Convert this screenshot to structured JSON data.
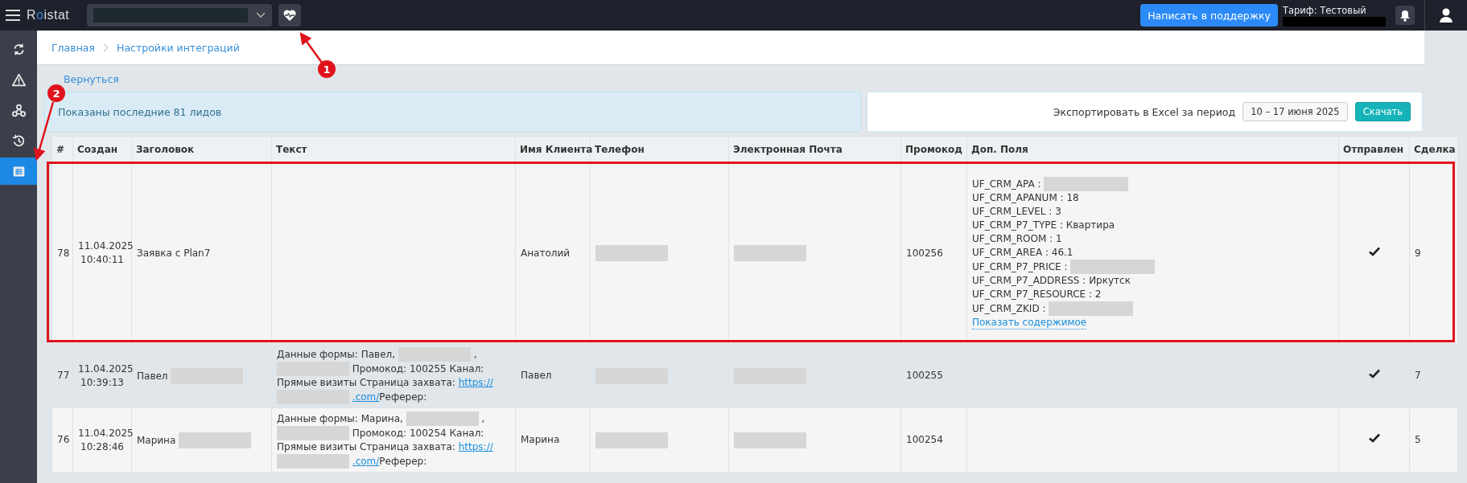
{
  "topbar": {
    "logo": "Roistat",
    "support_button": "Написать в поддержку",
    "tariff": "Тариф: Тестовый"
  },
  "sidebar": {
    "items": [
      {
        "selected": false
      },
      {
        "selected": false
      },
      {
        "selected": false
      },
      {
        "selected": false
      },
      {
        "selected": true
      }
    ]
  },
  "breadcrumbs": [
    "Главная",
    "Настройки интеграций"
  ],
  "back_link": "Вернуться",
  "info": "Показаны последние 81 лидов",
  "export": {
    "label": "Экспортировать в Excel за период",
    "period": "10 – 17 июня 2025",
    "button": "Скачать"
  },
  "table": {
    "columns": [
      "#",
      "Создан",
      "Заголовок",
      "Текст",
      "Имя Клиента",
      "Телефон",
      "Электронная Почта",
      "Промокод",
      "Доп. Поля",
      "Отправлен",
      "Сделка"
    ],
    "rows": [
      {
        "num": "78",
        "date": "11.04.2025",
        "time": "10:40:11",
        "title": "Заявка с Plan7",
        "title_redacted": false,
        "text": [],
        "client": "Анатолий",
        "promo": "100256",
        "highlighted": false,
        "framed": true,
        "sent": true,
        "deal": "9",
        "extra": [
          {
            "kind": "redacted",
            "label": "UF_CRM_APA :"
          },
          {
            "kind": "text",
            "label": "UF_CRM_APANUM : 18"
          },
          {
            "kind": "text",
            "label": "UF_CRM_LEVEL : 3"
          },
          {
            "kind": "text",
            "label": "UF_CRM_P7_TYPE : Квартира"
          },
          {
            "kind": "text",
            "label": "UF_CRM_ROOM : 1"
          },
          {
            "kind": "text",
            "label": "UF_CRM_AREA : 46.1"
          },
          {
            "kind": "redacted",
            "label": "UF_CRM_P7_PRICE :"
          },
          {
            "kind": "text",
            "label": "UF_CRM_P7_ADDRESS : Иркутск"
          },
          {
            "kind": "text",
            "label": "UF_CRM_P7_RESOURCE : 2"
          },
          {
            "kind": "redacted",
            "label": "UF_CRM_ZKID :"
          }
        ],
        "extra_link": "Показать содержимое"
      },
      {
        "num": "77",
        "date": "11.04.2025",
        "time": "10:39:13",
        "title": "Павел",
        "title_redacted": true,
        "client": "Павел",
        "promo": "100255",
        "highlighted": true,
        "framed": false,
        "sent": true,
        "deal": "7",
        "extra": [],
        "text": [
          {
            "kind": "text",
            "text": "Данные формы: Павел,"
          },
          {
            "kind": "redacted"
          },
          {
            "kind": "text",
            "text": ","
          },
          {
            "kind": "redacted"
          },
          {
            "kind": "text",
            "text": "Промокод: 100255 Канал: Прямые визиты Страница захвата:"
          },
          {
            "kind": "link",
            "text": "https://"
          },
          {
            "kind": "redacted"
          },
          {
            "kind": "link",
            "text": ".com/"
          },
          {
            "kind": "text",
            "text": "Реферер:"
          }
        ]
      },
      {
        "num": "76",
        "date": "11.04.2025",
        "time": "10:28:46",
        "title": "Марина",
        "title_redacted": true,
        "client": "Марина",
        "promo": "100254",
        "highlighted": false,
        "framed": false,
        "sent": true,
        "deal": "5",
        "extra": [],
        "text": [
          {
            "kind": "text",
            "text": "Данные формы: Марина,"
          },
          {
            "kind": "redacted"
          },
          {
            "kind": "text",
            "text": ","
          },
          {
            "kind": "redacted"
          },
          {
            "kind": "text",
            "text": "Промокод: 100254 Канал: Прямые визиты Страница захвата:"
          },
          {
            "kind": "link",
            "text": "https://"
          },
          {
            "kind": "redacted"
          },
          {
            "kind": "link",
            "text": ".com/"
          },
          {
            "kind": "text",
            "text": "Реферер:"
          }
        ]
      }
    ]
  },
  "annotations": [
    {
      "label": "1"
    },
    {
      "label": "2"
    }
  ]
}
